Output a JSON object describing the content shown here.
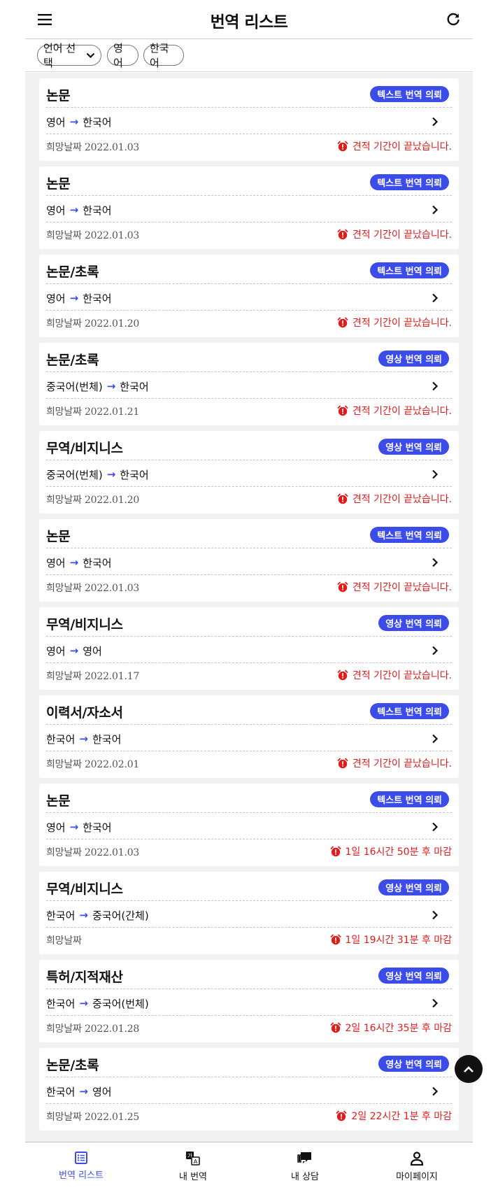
{
  "header": {
    "title": "번역 리스트",
    "menu_icon": "menu-icon",
    "refresh_icon": "refresh-icon"
  },
  "filters": {
    "language_select": "언어 선택",
    "source_lang": "영어",
    "target_lang": "한국어"
  },
  "arrow": "→",
  "colors": {
    "accent": "#3c4ce8",
    "deadline": "#e21b1b"
  },
  "requests": [
    {
      "title": "논문",
      "badge": "텍스트 번역 의뢰",
      "from": "영어",
      "to": "한국어",
      "date": "희망날짜 2022.01.03",
      "status": "견적 기간이 끝났습니다."
    },
    {
      "title": "논문",
      "badge": "텍스트 번역 의뢰",
      "from": "영어",
      "to": "한국어",
      "date": "희망날짜 2022.01.03",
      "status": "견적 기간이 끝났습니다."
    },
    {
      "title": "논문/초록",
      "badge": "텍스트 번역 의뢰",
      "from": "영어",
      "to": "한국어",
      "date": "희망날짜 2022.01.20",
      "status": "견적 기간이 끝났습니다."
    },
    {
      "title": "논문/초록",
      "badge": "영상 번역 의뢰",
      "from": "중국어(번체)",
      "to": "한국어",
      "date": "희망날짜 2022.01.21",
      "status": "견적 기간이 끝났습니다."
    },
    {
      "title": "무역/비지니스",
      "badge": "영상 번역 의뢰",
      "from": "중국어(번체)",
      "to": "한국어",
      "date": "희망날짜 2022.01.20",
      "status": "견적 기간이 끝났습니다."
    },
    {
      "title": "논문",
      "badge": "텍스트 번역 의뢰",
      "from": "영어",
      "to": "한국어",
      "date": "희망날짜 2022.01.03",
      "status": "견적 기간이 끝났습니다."
    },
    {
      "title": "무역/비지니스",
      "badge": "영상 번역 의뢰",
      "from": "영어",
      "to": "영어",
      "date": "희망날짜 2022.01.17",
      "status": "견적 기간이 끝났습니다."
    },
    {
      "title": "이력서/자소서",
      "badge": "텍스트 번역 의뢰",
      "from": "한국어",
      "to": "한국어",
      "date": "희망날짜 2022.02.01",
      "status": "견적 기간이 끝났습니다."
    },
    {
      "title": "논문",
      "badge": "텍스트 번역 의뢰",
      "from": "영어",
      "to": "한국어",
      "date": "희망날짜 2022.01.03",
      "status": "1일 16시간 50분 후 마감"
    },
    {
      "title": "무역/비지니스",
      "badge": "영상 번역 의뢰",
      "from": "한국어",
      "to": "중국어(간체)",
      "date": "희망날짜",
      "status": "1일 19시간 31분 후 마감"
    },
    {
      "title": "특허/지적재산",
      "badge": "영상 번역 의뢰",
      "from": "한국어",
      "to": "중국어(번체)",
      "date": "희망날짜 2022.01.28",
      "status": "2일 16시간 35분 후 마감"
    },
    {
      "title": "논문/초록",
      "badge": "영상 번역 의뢰",
      "from": "한국어",
      "to": "영어",
      "date": "희망날짜 2022.01.25",
      "status": "2일 22시간 1분 후 마감"
    }
  ],
  "bottom_nav": [
    {
      "label": "번역 리스트",
      "icon": "list-icon",
      "active": true
    },
    {
      "label": "내 번역",
      "icon": "translate-icon",
      "active": false
    },
    {
      "label": "내 상담",
      "icon": "chat-icon",
      "active": false
    },
    {
      "label": "마이페이지",
      "icon": "person-icon",
      "active": false
    }
  ]
}
